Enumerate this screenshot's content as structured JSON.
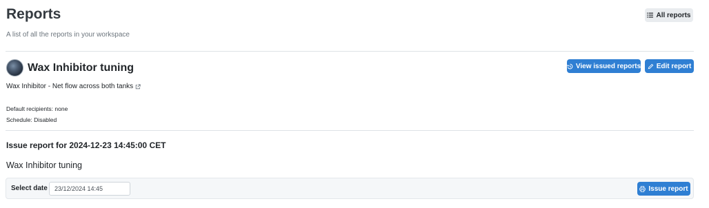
{
  "header": {
    "title": "Reports",
    "subtitle": "A list of all the reports in your workspace",
    "all_reports_label": "All reports"
  },
  "report": {
    "title": "Wax Inhibitor tuning",
    "view_issued_label": "View issued reports",
    "edit_label": "Edit report",
    "dashboard_link": "Wax Inhibitor - Net flow across both tanks",
    "recipients": "Default recipients: none",
    "schedule": "Schedule: Disabled"
  },
  "issue": {
    "heading": "Issue report for 2024-12-23 14:45:00 CET",
    "name": "Wax Inhibitor tuning",
    "date_label": "Select date",
    "date_value": "23/12/2024 14:45",
    "issue_button_label": "Issue report"
  },
  "colors": {
    "primary": "#2f7fd3",
    "light_button": "#e9ecef"
  },
  "icons": {
    "all_reports": "list-icon",
    "view_issued": "history-icon",
    "edit": "pencil-icon",
    "dashboard_link": "external-link-icon",
    "issue": "printer-icon"
  }
}
